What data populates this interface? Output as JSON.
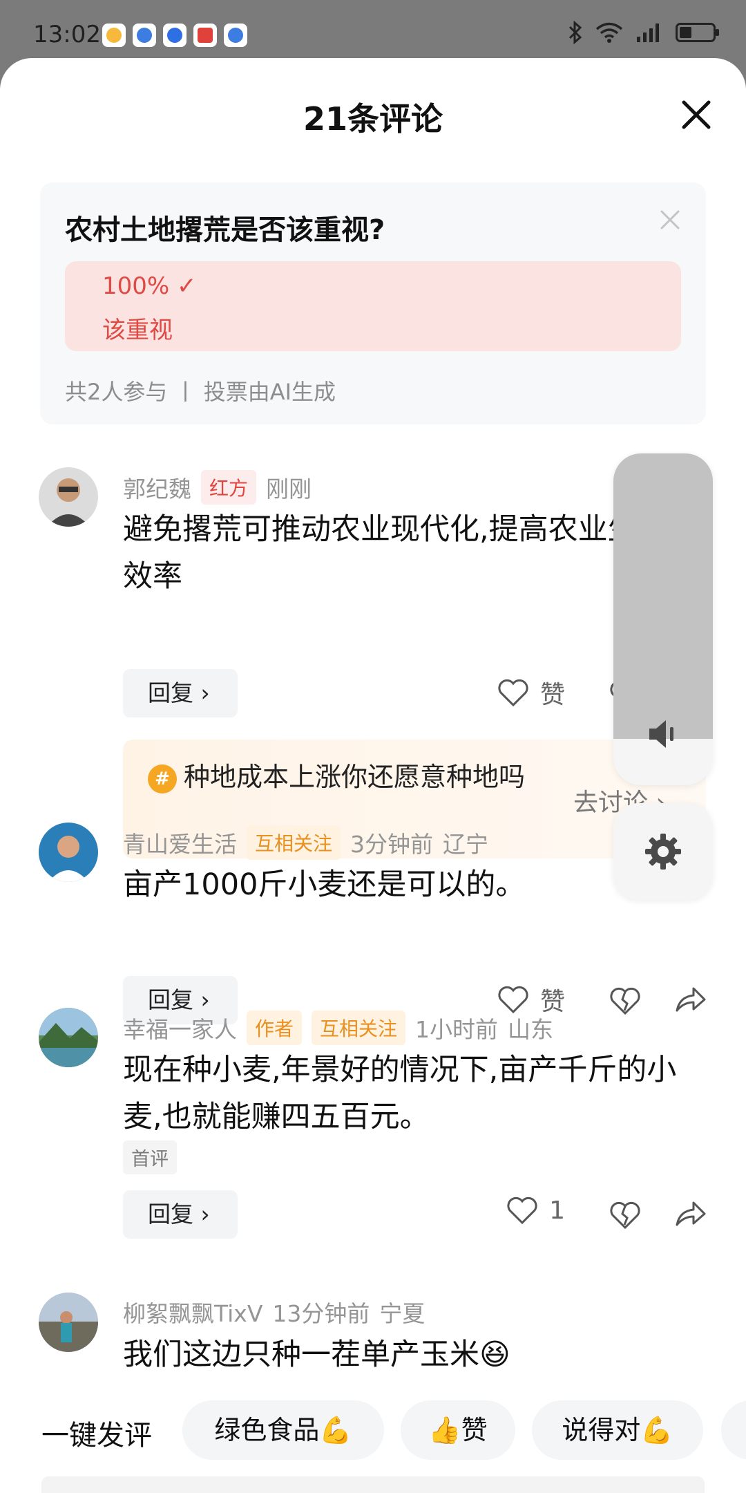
{
  "status_bar": {
    "time": "13:02"
  },
  "sheet": {
    "title": "21条评论"
  },
  "poll": {
    "question": "农村土地撂荒是否该重视?",
    "option_percent": "100% ✓",
    "option_label": "该重视",
    "footer": "共2人参与 丨 投票由AI生成"
  },
  "comments": [
    {
      "user": "郭纪魏",
      "tags": [
        "红方"
      ],
      "time": "刚刚",
      "location": "",
      "text": "避免撂荒可推动农业现代化,提高农业生产效率",
      "reply_label": "回复 ›",
      "like_label": "赞"
    },
    {
      "user": "青山爱生活",
      "tags": [
        "互相关注"
      ],
      "time": "3分钟前",
      "location": "辽宁",
      "text": "亩产1000斤小麦还是可以的。",
      "reply_label": "回复 ›",
      "like_label": "赞"
    },
    {
      "user": "幸福一家人",
      "tags": [
        "作者",
        "互相关注"
      ],
      "time": "1小时前",
      "location": "山东",
      "text": "现在种小麦,年景好的情况下,亩产千斤的小麦,也就能赚四五百元。",
      "badge": "首评",
      "reply_label": "回复 ›",
      "like_label": "1"
    },
    {
      "user": "柳絮飘飘TixV",
      "tags": [],
      "time": "13分钟前",
      "location": "宁夏",
      "text": "我们这边只种一茬单产玉米😆"
    }
  ],
  "topic": {
    "hash": "#",
    "text": "种地成本上涨你还愿意种地吗",
    "link": "去讨论 ›"
  },
  "quick_comment": {
    "label": "一键发评",
    "chips": [
      "绿色食品💪",
      "👍赞",
      "说得对💪"
    ]
  },
  "colors": {
    "accent_red": "#e04a44",
    "tag_orange": "#e9901f",
    "overlay_gray": "#c2c2c2"
  },
  "overlay": {
    "volume_level_percent": 86
  }
}
